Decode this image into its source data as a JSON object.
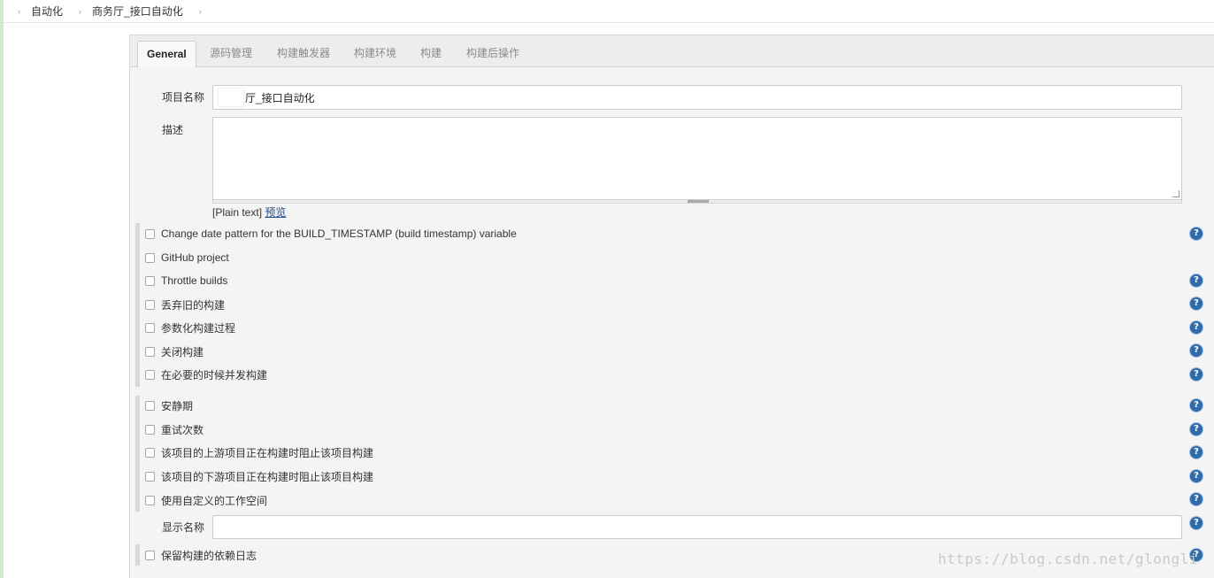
{
  "breadcrumbs": [
    {
      "label": "自动化"
    },
    {
      "label": "商务厅_接口自动化"
    }
  ],
  "tabs": [
    "General",
    "源码管理",
    "构建触发器",
    "构建环境",
    "构建",
    "构建后操作"
  ],
  "form": {
    "project_name_label": "项目名称",
    "project_name_value": "厅_接口自动化",
    "description_label": "描述",
    "description_value": "",
    "plain_text": "[Plain text]",
    "preview_link": "预览",
    "display_name_label": "显示名称",
    "display_name_value": ""
  },
  "options_group1": [
    {
      "label": "Change date pattern for the BUILD_TIMESTAMP (build timestamp) variable",
      "checked": false,
      "help": true
    },
    {
      "label": "GitHub project",
      "checked": false,
      "help": false
    },
    {
      "label": "Throttle builds",
      "checked": false,
      "help": true
    },
    {
      "label": "丢弃旧的构建",
      "checked": false,
      "help": true
    },
    {
      "label": "参数化构建过程",
      "checked": false,
      "help": true
    },
    {
      "label": "关闭构建",
      "checked": false,
      "help": true
    },
    {
      "label": "在必要的时候并发构建",
      "checked": false,
      "help": true
    }
  ],
  "options_group2": [
    {
      "label": "安静期",
      "checked": false,
      "help": true
    },
    {
      "label": "重试次数",
      "checked": false,
      "help": true
    },
    {
      "label": "该项目的上游项目正在构建时阻止该项目构建",
      "checked": false,
      "help": true
    },
    {
      "label": "该项目的下游项目正在构建时阻止该项目构建",
      "checked": false,
      "help": true
    },
    {
      "label": "使用自定义的工作空间",
      "checked": false,
      "help": true
    }
  ],
  "options_group3": [
    {
      "label": "保留构建的依赖日志",
      "checked": false,
      "help": true
    }
  ],
  "help_glyph": "?",
  "watermark": "https://blog.csdn.net/glongli",
  "colors": {
    "accent_link": "#204a87",
    "help_icon": "#2f6ba8",
    "panel_bg": "#f4f4f4"
  }
}
